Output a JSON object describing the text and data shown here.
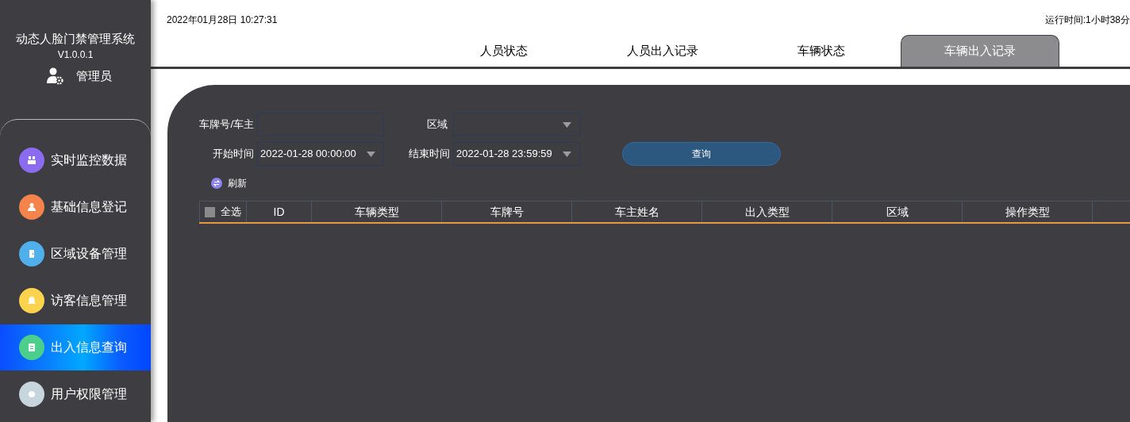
{
  "sidebar": {
    "title": "动态人脸门禁管理系统",
    "version": "V1.0.0.1",
    "user": "管理员",
    "items": [
      {
        "label": "实时监控数据",
        "color": "#8b6cf0",
        "selected": false
      },
      {
        "label": "基础信息登记",
        "color": "#f5844c",
        "selected": false
      },
      {
        "label": "区域设备管理",
        "color": "#4fb0ec",
        "selected": false
      },
      {
        "label": "访客信息管理",
        "color": "#fcd34d",
        "selected": false
      },
      {
        "label": "出入信息查询",
        "color": "#4ccf8a",
        "selected": true
      },
      {
        "label": "用户权限管理",
        "color": "#c7d6dc",
        "selected": false
      }
    ]
  },
  "header": {
    "datetime": "2022年01月28日 10:27:31",
    "runtime": "运行时间:1小时38分"
  },
  "tabs": [
    {
      "label": "人员状态",
      "selected": false
    },
    {
      "label": "人员出入记录",
      "selected": false
    },
    {
      "label": "车辆状态",
      "selected": false
    },
    {
      "label": "车辆出入记录",
      "selected": true
    }
  ],
  "filters": {
    "plate_owner": {
      "label": "车牌号/车主"
    },
    "area": {
      "label": "区域"
    },
    "start_time": {
      "label": "开始时间",
      "value": "2022-01-28 00:00:00"
    },
    "end_time": {
      "label": "结束时间",
      "value": "2022-01-28 23:59:59"
    },
    "query_button": "查询",
    "refresh": "刷新"
  },
  "table": {
    "select_all": {
      "label": "全选",
      "checked": false
    },
    "columns": [
      "ID",
      "车辆类型",
      "车牌号",
      "车主姓名",
      "出入类型",
      "区域",
      "操作类型"
    ]
  }
}
